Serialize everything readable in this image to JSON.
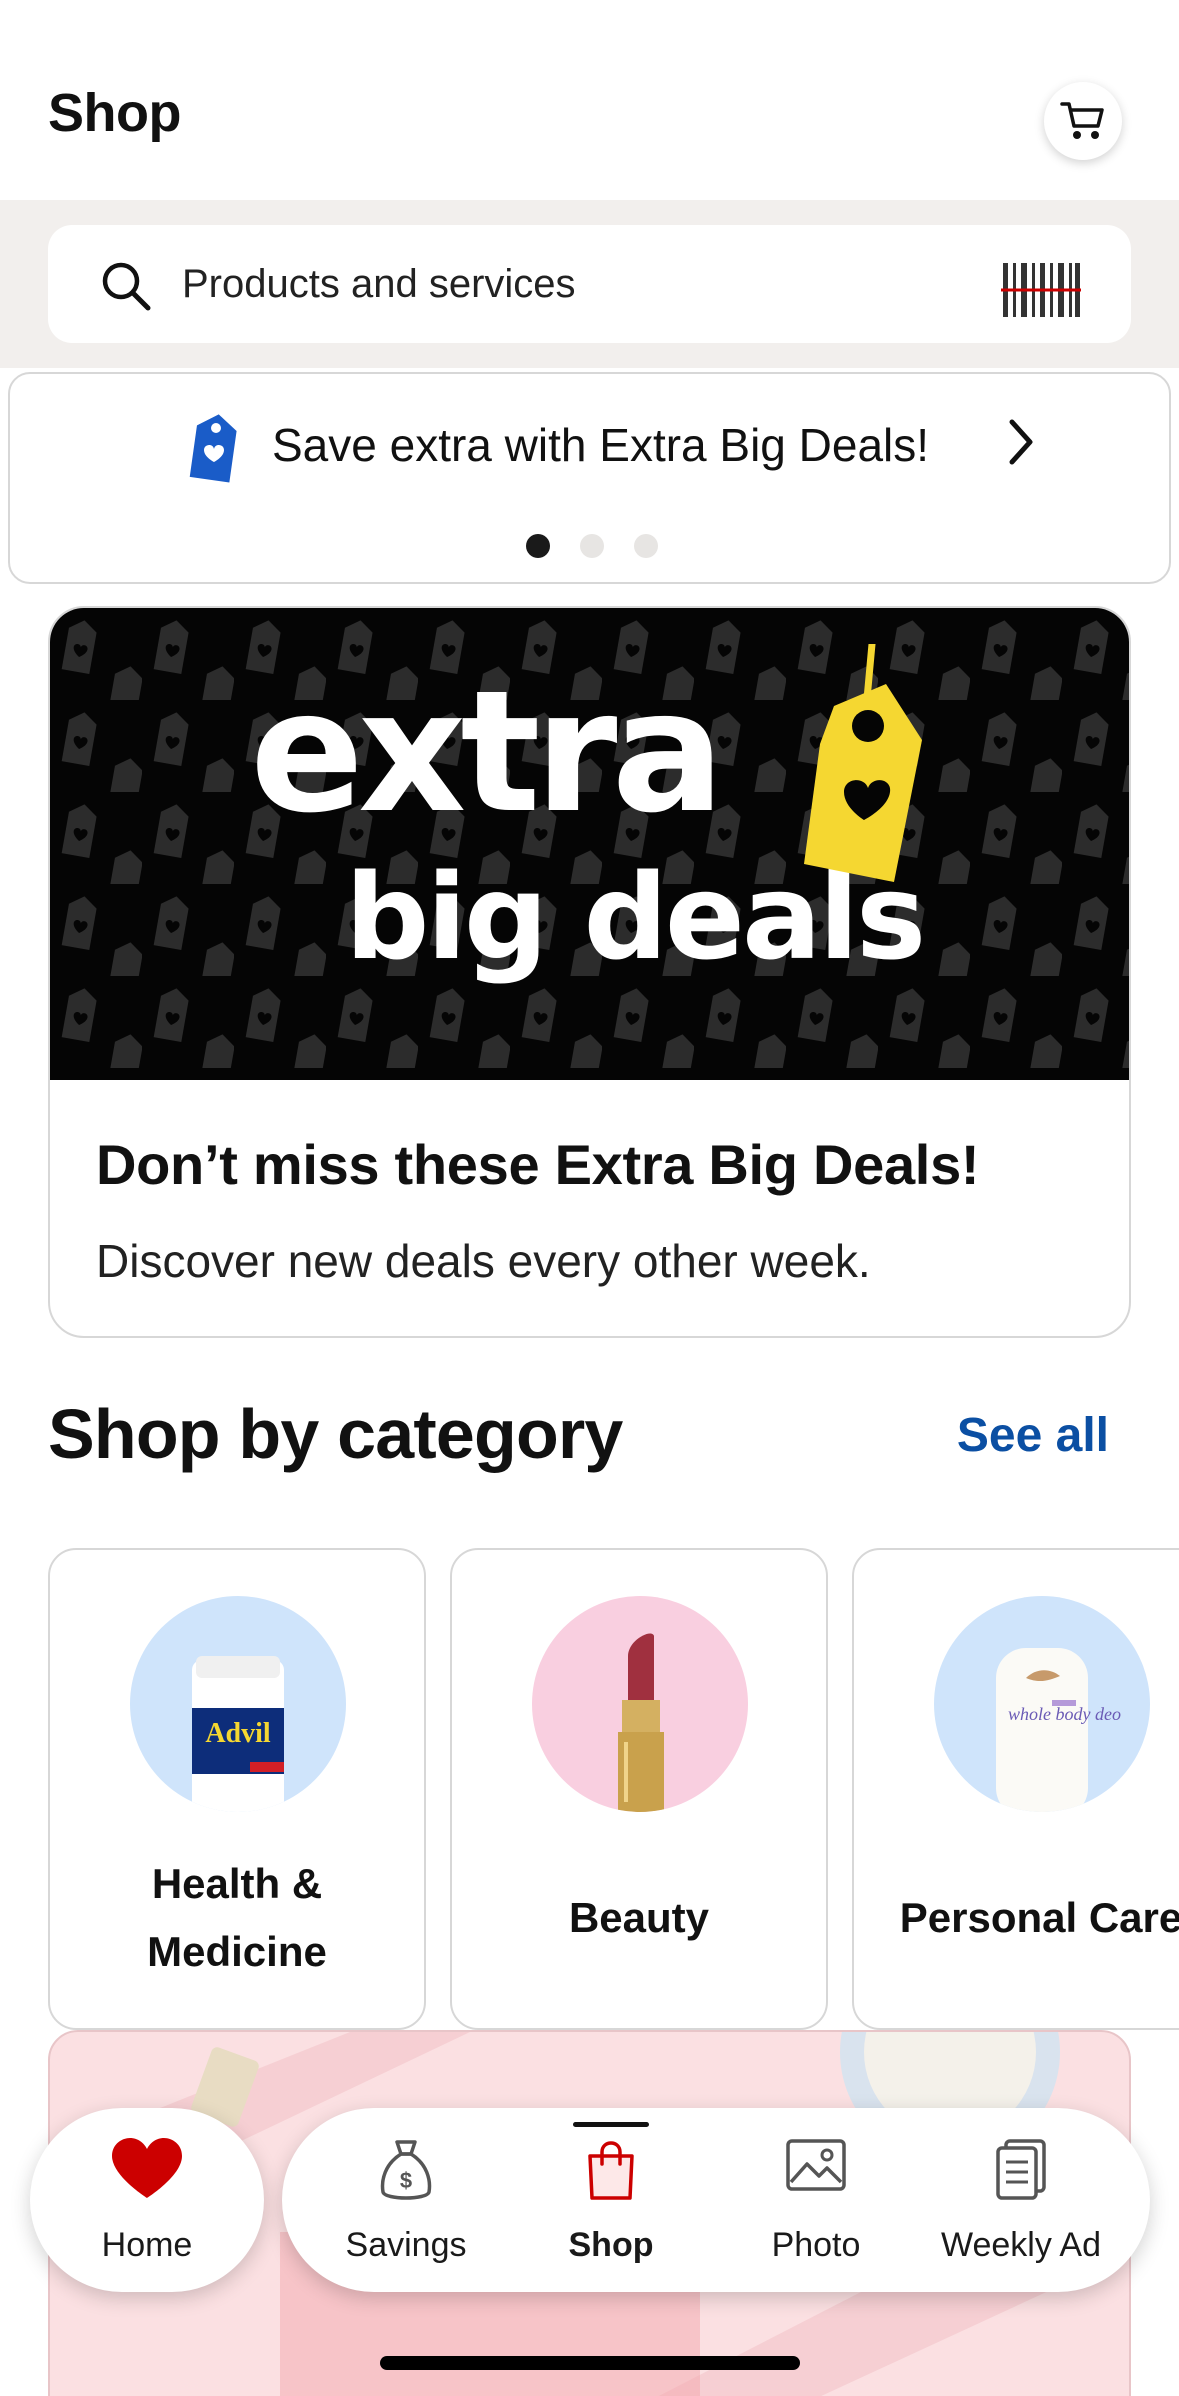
{
  "header": {
    "title": "Shop"
  },
  "search": {
    "placeholder": "Products and services"
  },
  "promo": {
    "text": "Save extra with Extra Big Deals!",
    "carousel_total": 3,
    "carousel_active": 1
  },
  "hero": {
    "logo_word_1": "extra",
    "logo_word_2": "big deals",
    "title": "Don’t miss these Extra Big Deals!",
    "subtitle": "Discover new deals every other week."
  },
  "categories_section": {
    "title": "Shop by category",
    "see_all": "See all",
    "items": [
      {
        "label_line1": "Health &",
        "label_line2": "Medicine",
        "circle_color": "#cfe4fb",
        "icon": "pill-bottle-icon",
        "product_text": "Advil"
      },
      {
        "label_line1": "Beauty",
        "label_line2": "",
        "circle_color": "#f9cfe0",
        "icon": "lipstick-icon"
      },
      {
        "label_line1": "Personal Care",
        "label_line2": "",
        "circle_color": "#cfe4fb",
        "icon": "deodorant-icon",
        "product_text": "whole body deo"
      }
    ]
  },
  "nav": {
    "home": "Home",
    "savings": "Savings",
    "shop": "Shop",
    "photo": "Photo",
    "weekly_ad": "Weekly Ad",
    "active": "Shop"
  },
  "colors": {
    "brand_red": "#cc0000",
    "link_blue": "#0b4fa3",
    "tag_yellow": "#f5d731",
    "search_band": "#f2efed"
  }
}
